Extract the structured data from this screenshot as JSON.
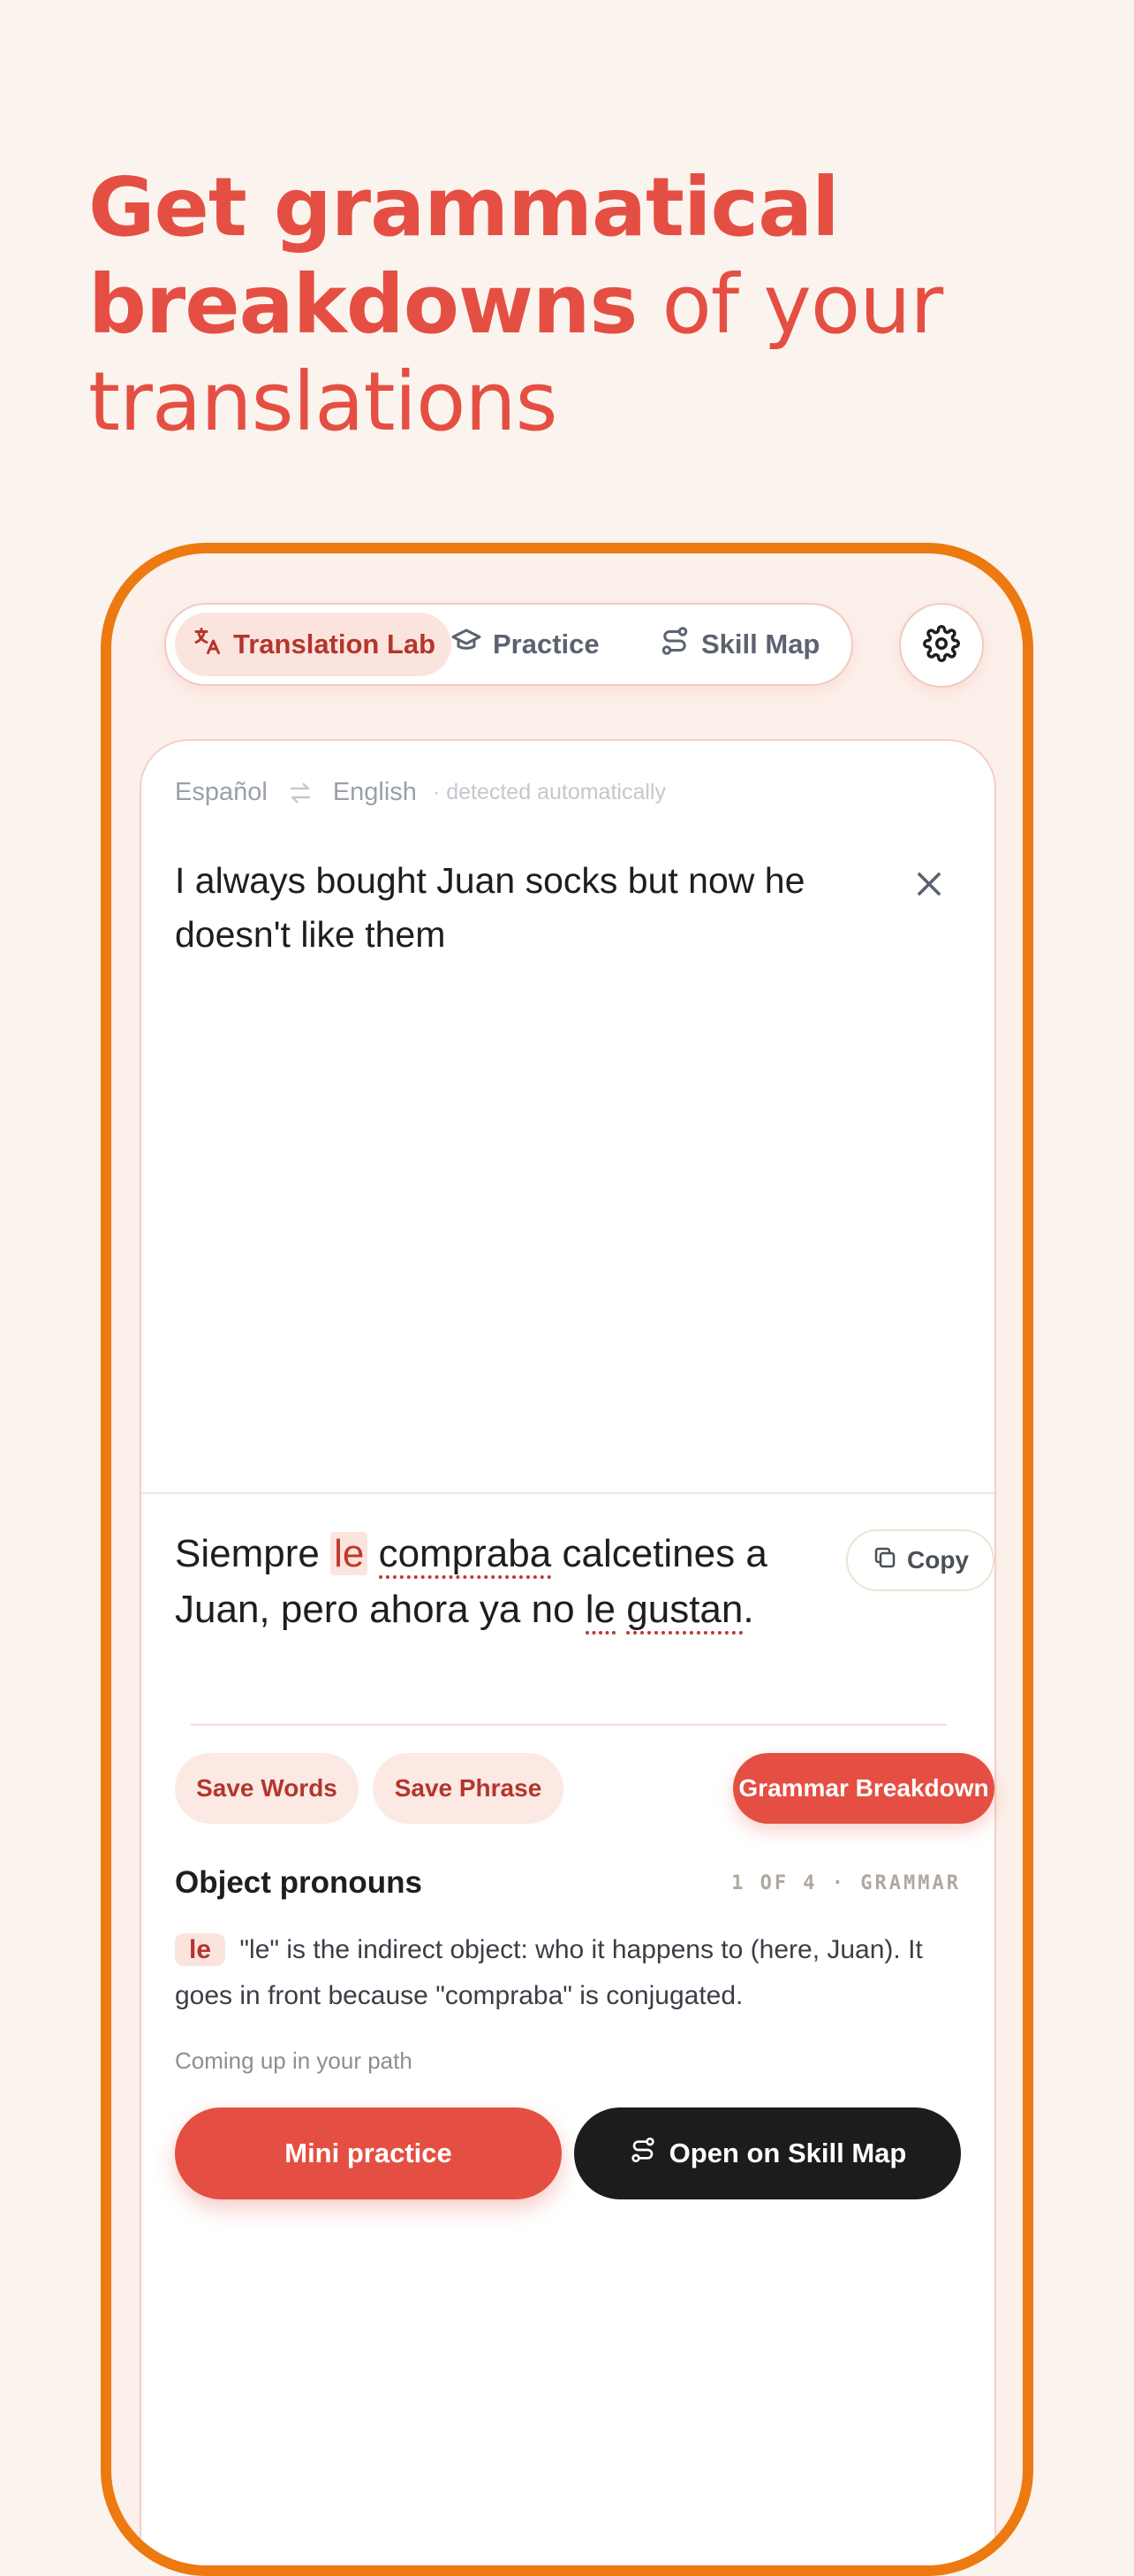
{
  "headline": {
    "bold1": "Get grammatical",
    "bold2": "breakdowns",
    "light1": " of your",
    "light2": "translations"
  },
  "nav": {
    "tabs": [
      {
        "label": "Translation Lab",
        "icon": "translate-icon",
        "active": true
      },
      {
        "label": "Practice",
        "icon": "graduation-cap-icon",
        "active": false
      },
      {
        "label": "Skill Map",
        "icon": "route-icon",
        "active": false
      }
    ],
    "settings_icon": "gear-icon"
  },
  "translator": {
    "source_lang": "Español",
    "target_lang": "English",
    "detected_note": "· detected automatically",
    "source_text": "I always bought Juan socks but now he doesn't like them",
    "output": {
      "w1": "Siempre",
      "w2": "le",
      "w3": "compraba",
      "w4": "calcetines a Juan, pero ahora ya no",
      "w5": "le",
      "w6": "gustan",
      "w7": "."
    },
    "copy_label": "Copy"
  },
  "actions": {
    "save_words": "Save Words",
    "save_phrase": "Save Phrase",
    "grammar_breakdown": "Grammar Breakdown"
  },
  "grammar": {
    "title": "Object pronouns",
    "meta": "1 OF 4 · GRAMMAR",
    "tag": "le",
    "explanation": "\"le\" is the indirect object: who it happens to (here, Juan). It goes in front because \"compraba\" is conjugated.",
    "coming_up": "Coming up in your path",
    "mini_practice": "Mini practice",
    "open_skill_map": "Open on Skill Map"
  },
  "colors": {
    "accent": "#E54F43",
    "frame": "#EC7A10",
    "background": "#FBF4EE"
  }
}
